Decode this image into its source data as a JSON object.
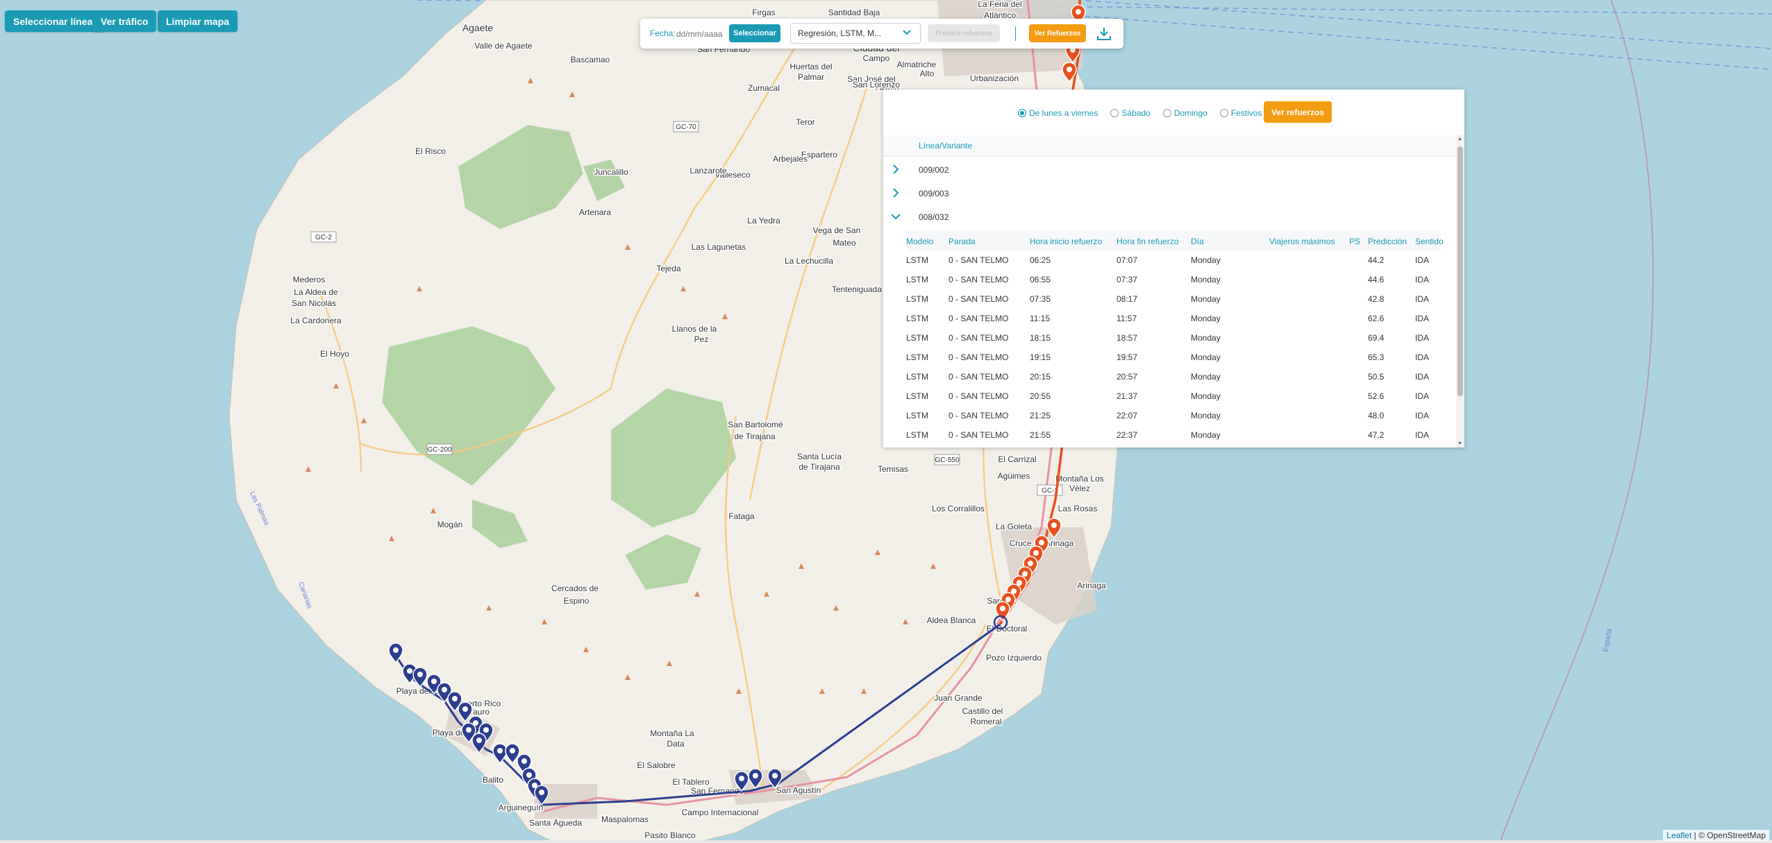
{
  "top_buttons": {
    "select_lines": "Seleccionar líneas",
    "traffic": "Ver tráfico",
    "clear_map": "Limpiar mapa"
  },
  "toolbar": {
    "date_label": "Fecha:",
    "date_placeholder": "dd/mm/aaaa",
    "select_button": "Seleccionar",
    "model_value": "Regresión, LSTM, M...",
    "predict_button": "Predecir refuerzos",
    "view_button": "Ver Refuerzos",
    "download_icon": "download-icon"
  },
  "panel": {
    "day_options": [
      {
        "label": "De lunes a viernes",
        "selected": true
      },
      {
        "label": "Sábado",
        "selected": false
      },
      {
        "label": "Domingo",
        "selected": false
      },
      {
        "label": "Festivos",
        "selected": false
      }
    ],
    "view_refuerzos_button": "Ver refuerzos",
    "line_header": "Línea/Variante",
    "lines": [
      {
        "label": "009/002",
        "expanded": false
      },
      {
        "label": "009/003",
        "expanded": false
      },
      {
        "label": "008/032",
        "expanded": true
      }
    ],
    "columns": [
      "Modelo",
      "Parada",
      "Hora inicio refuerzo",
      "Hora fin refuerzo",
      "Día",
      "Viajeros máximos",
      "PS",
      "Predicción",
      "Sentido"
    ],
    "rows": [
      [
        "LSTM",
        "0 - SAN TELMO",
        "06:25",
        "07:07",
        "Monday",
        "",
        "",
        "44.2",
        "IDA"
      ],
      [
        "LSTM",
        "0 - SAN TELMO",
        "06:55",
        "07:37",
        "Monday",
        "",
        "",
        "44.6",
        "IDA"
      ],
      [
        "LSTM",
        "0 - SAN TELMO",
        "07:35",
        "08:17",
        "Monday",
        "",
        "",
        "42.8",
        "IDA"
      ],
      [
        "LSTM",
        "0 - SAN TELMO",
        "11:15",
        "11:57",
        "Monday",
        "",
        "",
        "62.6",
        "IDA"
      ],
      [
        "LSTM",
        "0 - SAN TELMO",
        "18:15",
        "18:57",
        "Monday",
        "",
        "",
        "69.4",
        "IDA"
      ],
      [
        "LSTM",
        "0 - SAN TELMO",
        "19:15",
        "19:57",
        "Monday",
        "",
        "",
        "65.3",
        "IDA"
      ],
      [
        "LSTM",
        "0 - SAN TELMO",
        "20:15",
        "20:57",
        "Monday",
        "",
        "",
        "50.5",
        "IDA"
      ],
      [
        "LSTM",
        "0 - SAN TELMO",
        "20:55",
        "21:37",
        "Monday",
        "",
        "",
        "52.6",
        "IDA"
      ],
      [
        "LSTM",
        "0 - SAN TELMO",
        "21:25",
        "22:07",
        "Monday",
        "",
        "",
        "48.0",
        "IDA"
      ],
      [
        "LSTM",
        "0 - SAN TELMO",
        "21:55",
        "22:37",
        "Monday",
        "",
        "",
        "47.2",
        "IDA"
      ]
    ]
  },
  "map": {
    "colors": {
      "sea": "#aad3df",
      "land": "#f2efe9",
      "forest": "#add19e",
      "blue_route": "#2e3e8e",
      "orange_route": "#e8501e"
    },
    "places": [
      {
        "name": "Agaete"
      },
      {
        "name": "Valle de Agaete"
      },
      {
        "name": "Firgas"
      },
      {
        "name": "Santidad Baja"
      },
      {
        "name": "La Feria del"
      },
      {
        "name": "Atlántico"
      },
      {
        "name": "San Fernando"
      },
      {
        "name": "Bascamao"
      },
      {
        "name": "Huertas del"
      },
      {
        "name": "Palmar"
      },
      {
        "name": "Ciudad del"
      },
      {
        "name": "Campo"
      },
      {
        "name": "Almatriche"
      },
      {
        "name": "Alto"
      },
      {
        "name": "San José del"
      },
      {
        "name": "Álamo"
      },
      {
        "name": "San Lorenzo"
      },
      {
        "name": "Zumacal"
      },
      {
        "name": "Urbanización"
      },
      {
        "name": "El Risco"
      },
      {
        "name": "Valleseco"
      },
      {
        "name": "Teror"
      },
      {
        "name": "Espartero"
      },
      {
        "name": "Arbejales"
      },
      {
        "name": "Juncalillo"
      },
      {
        "name": "Lanzarote"
      },
      {
        "name": "Artenara"
      },
      {
        "name": "La Yedra"
      },
      {
        "name": "Las Lagunetas"
      },
      {
        "name": "Vega de San"
      },
      {
        "name": "Mateo"
      },
      {
        "name": "La Lechucilla"
      },
      {
        "name": "Tejeda"
      },
      {
        "name": "Tenteniguada"
      },
      {
        "name": "Mederos"
      },
      {
        "name": "La Aldea de"
      },
      {
        "name": "San Nicolás"
      },
      {
        "name": "La Cardonera"
      },
      {
        "name": "El Hoyo"
      },
      {
        "name": "Llanos de la"
      },
      {
        "name": "Pez"
      },
      {
        "name": "San Bartolomé"
      },
      {
        "name": "de Tirajana"
      },
      {
        "name": "Santa Lucía"
      },
      {
        "name": "de Tirajana"
      },
      {
        "name": "Temisas"
      },
      {
        "name": "El Carrizal"
      },
      {
        "name": "Agüimes"
      },
      {
        "name": "Montaña Los"
      },
      {
        "name": "Vélez"
      },
      {
        "name": "Los Corralillos"
      },
      {
        "name": "Las Rosas"
      },
      {
        "name": "La Goleta"
      },
      {
        "name": "Fataga"
      },
      {
        "name": "Mogán"
      },
      {
        "name": "Cruce de Arinaga"
      },
      {
        "name": "Arinaga"
      },
      {
        "name": "Sardina"
      },
      {
        "name": "Aldea Blanca"
      },
      {
        "name": "El Doctoral"
      },
      {
        "name": "Pozo Izquierdo"
      },
      {
        "name": "Cercados de"
      },
      {
        "name": "Espino"
      },
      {
        "name": "Juan Grande"
      },
      {
        "name": "Castillo del"
      },
      {
        "name": "Romeral"
      },
      {
        "name": "Montaña La"
      },
      {
        "name": "Data"
      },
      {
        "name": "El Salobre"
      },
      {
        "name": "El Tablero"
      },
      {
        "name": "San Fernando"
      },
      {
        "name": "San Agustín"
      },
      {
        "name": "Campo Internacional"
      },
      {
        "name": "Playa del Inglés"
      },
      {
        "name": "Maspalomas"
      },
      {
        "name": "Arguineguín"
      },
      {
        "name": "Santa Águeda"
      },
      {
        "name": "Pasito Blanco"
      },
      {
        "name": "Playa del Cura"
      },
      {
        "name": "Puerto Rico"
      },
      {
        "name": "Balito"
      },
      {
        "name": "Tauro"
      }
    ],
    "road_labels": [
      "GC-2",
      "GC-200",
      "GC-70",
      "GC-550",
      "GC-1"
    ],
    "sea_labels": [
      "Las Palmas",
      "Canarias",
      "España"
    ],
    "attribution_link": "Leaflet",
    "attribution_text": " | © OpenStreetMap"
  }
}
